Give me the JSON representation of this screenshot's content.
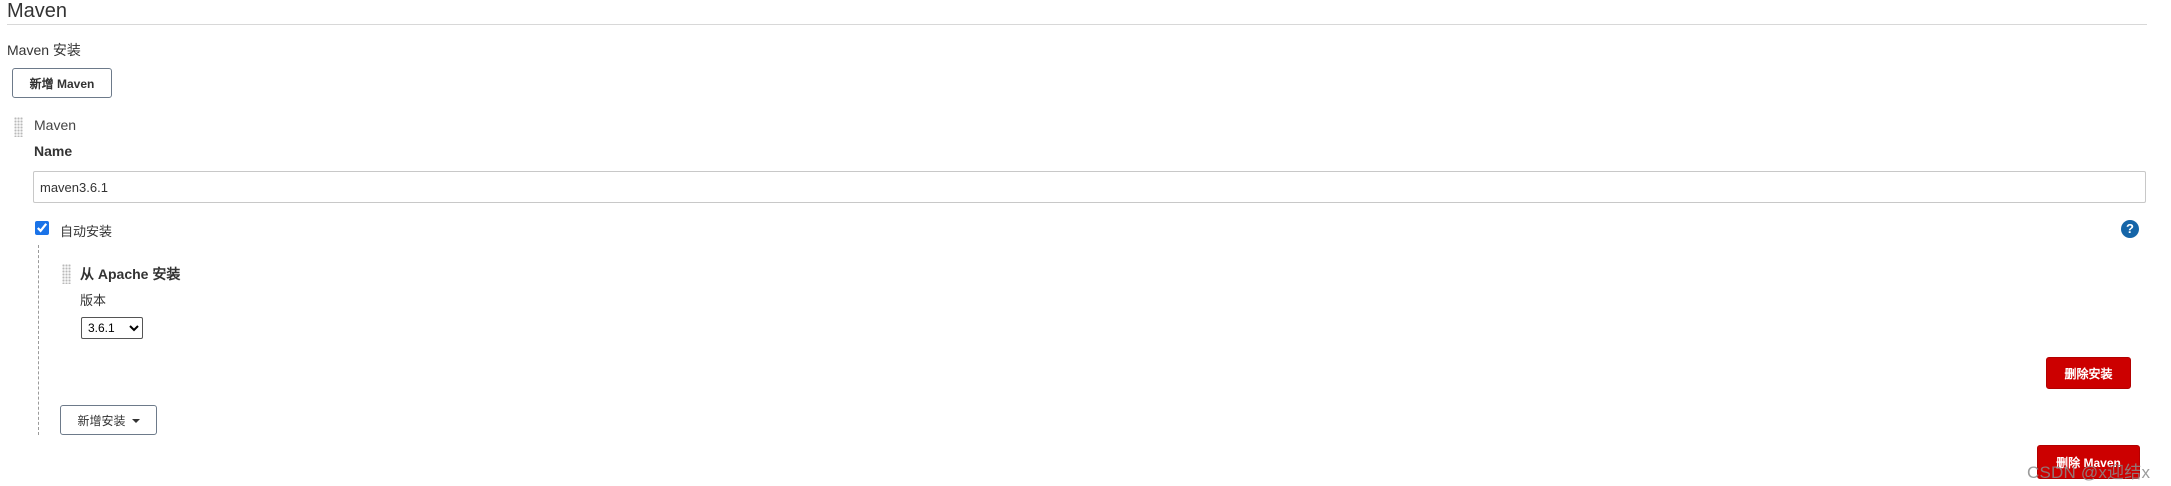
{
  "section": {
    "title": "Maven",
    "install_label": "Maven 安装",
    "add_maven_label": "新增 Maven"
  },
  "maven_entry": {
    "heading": "Maven",
    "name_label": "Name",
    "name_value": "maven3.6.1",
    "auto_install_label": "自动安装",
    "auto_install_checked": true,
    "help_icon_text": "?",
    "installer": {
      "title": "从 Apache 安装",
      "version_label": "版本",
      "version_selected": "3.6.1",
      "delete_install_label": "删除安装"
    },
    "add_install_label": "新增安装",
    "delete_maven_label": "删除 Maven"
  },
  "watermark": "CSDN @x迎结x",
  "colors": {
    "danger": "#cc0000",
    "help": "#1565a8",
    "checkbox": "#1a73e8"
  },
  "icons": [
    "drag-handle-icon",
    "help-icon",
    "caret-down-icon"
  ]
}
